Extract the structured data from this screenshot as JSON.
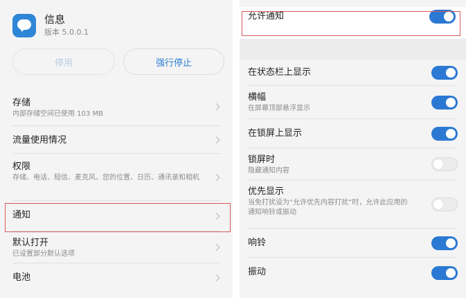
{
  "app": {
    "name": "信息",
    "version": "版本 5.0.0.1"
  },
  "buttons": {
    "disable": "停用",
    "force_stop": "强行停止"
  },
  "left_list": [
    {
      "title": "存储",
      "sub": "内部存储空间已使用 103 MB"
    },
    {
      "title": "流量使用情况",
      "sub": ""
    },
    {
      "title": "权限",
      "sub": "存储、电话、短信、麦克风、您的位置、日历、通讯录和相机"
    },
    {
      "title": "通知",
      "sub": ""
    },
    {
      "title": "默认打开",
      "sub": "已设置部分默认选项"
    },
    {
      "title": "电池",
      "sub": ""
    }
  ],
  "right": {
    "allow": {
      "title": "允许通知",
      "on": true
    },
    "items": [
      {
        "title": "在状态栏上显示",
        "sub": "",
        "on": true
      },
      {
        "title": "横幅",
        "sub": "在屏幕顶部悬浮显示",
        "on": true
      },
      {
        "title": "在锁屏上显示",
        "sub": "",
        "on": true
      },
      {
        "title": "锁屏时",
        "sub": "隐藏通知内容",
        "on": false
      },
      {
        "title": "优先显示",
        "sub": "当免打扰设为“允许优先内容打扰”时，允许此应用的通知响铃或振动",
        "on": false
      },
      {
        "title": "响铃",
        "sub": "",
        "on": true
      },
      {
        "title": "振动",
        "sub": "",
        "on": true
      }
    ]
  },
  "colors": {
    "accent": "#2b79d3",
    "highlight": "#d55a5a",
    "disabled_text": "#b9cde2"
  }
}
